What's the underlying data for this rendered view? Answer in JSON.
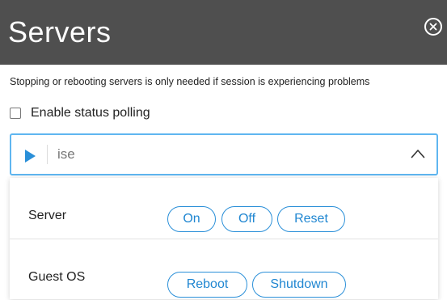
{
  "header": {
    "title": "Servers",
    "close_icon": "close-circle-icon"
  },
  "description": "Stopping or rebooting servers is only needed if session is experiencing problems",
  "polling": {
    "label": "Enable status polling",
    "checked": false
  },
  "selector": {
    "value": "ise",
    "expand_icon": "play-icon",
    "toggle_icon": "chevron-up-icon"
  },
  "panel": {
    "server": {
      "label": "Server",
      "buttons": {
        "on": "On",
        "off": "Off",
        "reset": "Reset"
      }
    },
    "guest_os": {
      "label": "Guest OS",
      "buttons": {
        "reboot": "Reboot",
        "shutdown": "Shutdown"
      }
    }
  },
  "colors": {
    "header_bg": "#4f4f4f",
    "accent": "#2a8fd8",
    "focus_border": "#5fb6f0"
  }
}
